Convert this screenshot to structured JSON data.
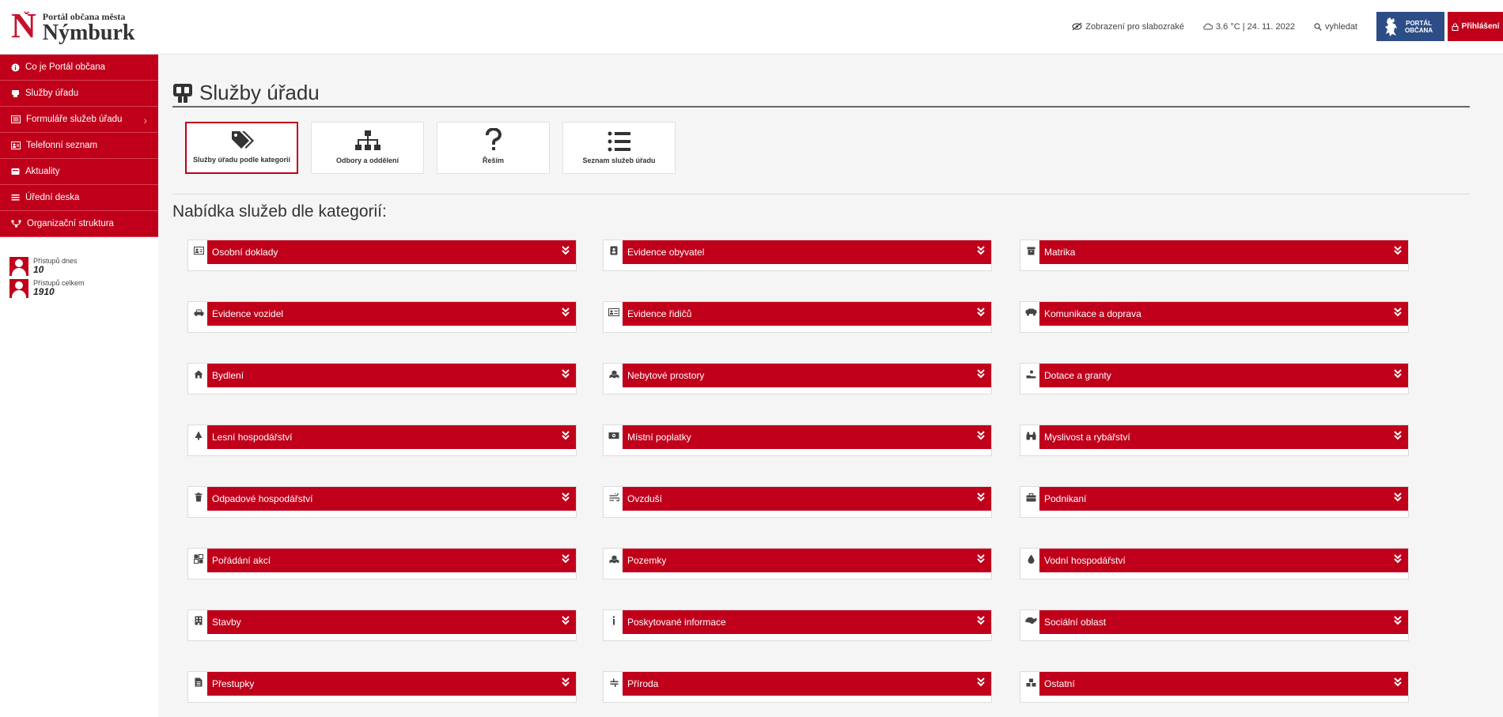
{
  "header": {
    "logo_letter": "N",
    "logo_subtitle": "Portál občana města",
    "logo_city": "Nýmburk",
    "accessibility": "Zobrazení pro slabozraké",
    "weather": "3.6 °C | 24. 11. 2022",
    "search": "vyhledat",
    "portal_label_1": "PORTÁL",
    "portal_label_2": "OBČANA",
    "login": "Přihlášení"
  },
  "sidebar": {
    "items": [
      {
        "label": "Co je Portál občana",
        "icon": "info-icon"
      },
      {
        "label": "Služby úřadu",
        "icon": "services-icon"
      },
      {
        "label": "Formuláře služeb úřadu",
        "icon": "forms-icon",
        "has_submenu": true
      },
      {
        "label": "Telefonní seznam",
        "icon": "contact-card-icon"
      },
      {
        "label": "Aktuality",
        "icon": "news-icon"
      },
      {
        "label": "Úřední deska",
        "icon": "board-icon"
      },
      {
        "label": "Organizační struktura",
        "icon": "org-icon"
      }
    ],
    "stats": [
      {
        "label": "Přístupů dnes",
        "value": "10"
      },
      {
        "label": "Přístupů celkem",
        "value": "1910"
      }
    ]
  },
  "main": {
    "title": "Služby úřadu",
    "tiles": [
      {
        "label": "Služby úřadu podle kategorií",
        "icon": "tags-icon",
        "active": true
      },
      {
        "label": "Odbory a oddělení",
        "icon": "sitemap-icon",
        "active": false
      },
      {
        "label": "Řeším",
        "icon": "question-icon",
        "active": false
      },
      {
        "label": "Seznam služeb úřadu",
        "icon": "list-icon",
        "active": false
      }
    ],
    "section_title": "Nabídka služeb dle kategorií:",
    "categories": [
      {
        "label": "Osobní doklady",
        "icon": "id-card-icon"
      },
      {
        "label": "Evidence obyvatel",
        "icon": "person-badge-icon"
      },
      {
        "label": "Matrika",
        "icon": "archive-icon"
      },
      {
        "label": "Evidence vozidel",
        "icon": "car-icon"
      },
      {
        "label": "Evidence řidičů",
        "icon": "driver-card-icon"
      },
      {
        "label": "Komunikace a doprava",
        "icon": "truck-icon"
      },
      {
        "label": "Bydlení",
        "icon": "home-icon"
      },
      {
        "label": "Nebytové prostory",
        "icon": "cubes-icon"
      },
      {
        "label": "Dotace a granty",
        "icon": "hand-coin-icon"
      },
      {
        "label": "Lesní hospodářství",
        "icon": "tree-icon"
      },
      {
        "label": "Místní poplatky",
        "icon": "money-icon"
      },
      {
        "label": "Myslivost a rybářství",
        "icon": "binoculars-icon"
      },
      {
        "label": "Odpadové hospodářství",
        "icon": "trash-icon"
      },
      {
        "label": "Ovzduší",
        "icon": "wind-icon"
      },
      {
        "label": "Podnikaní",
        "icon": "briefcase-icon"
      },
      {
        "label": "Pořádání akcí",
        "icon": "event-icon"
      },
      {
        "label": "Pozemky",
        "icon": "cubes-icon"
      },
      {
        "label": "Vodní hospodářství",
        "icon": "water-drop-icon"
      },
      {
        "label": "Stavby",
        "icon": "building-icon"
      },
      {
        "label": "Poskytované informace",
        "icon": "info-i-icon"
      },
      {
        "label": "Sociální oblast",
        "icon": "handshake-icon"
      },
      {
        "label": "Přestupky",
        "icon": "document-icon"
      },
      {
        "label": "Příroda",
        "icon": "nature-icon"
      },
      {
        "label": "Ostatní",
        "icon": "misc-icon"
      }
    ]
  },
  "colors": {
    "brand_red": "#c0001b",
    "portal_blue": "#2d4d86"
  }
}
